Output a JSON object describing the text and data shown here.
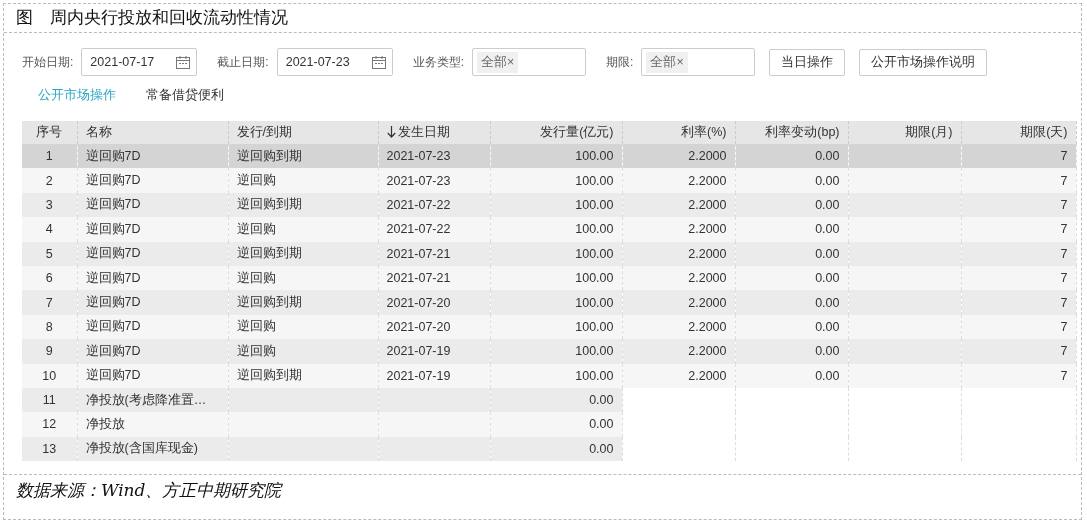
{
  "title": "图　周内央行投放和回收流动性情况",
  "filters": [
    {
      "kind": "date",
      "label": "开始日期:",
      "value": "2021-07-17"
    },
    {
      "kind": "date",
      "label": "截止日期:",
      "value": "2021-07-23"
    },
    {
      "kind": "tags",
      "label": "业务类型:",
      "tag": "全部",
      "remove": "×"
    },
    {
      "kind": "tags",
      "label": "期限:",
      "tag": "全部",
      "remove": "×"
    }
  ],
  "buttons": [
    "当日操作",
    "公开市场操作说明"
  ],
  "tabs": [
    {
      "label": "公开市场操作",
      "selected": true
    },
    {
      "label": "常备借贷便利",
      "selected": false
    }
  ],
  "table": {
    "columns": [
      {
        "label": "序号",
        "sorted": false
      },
      {
        "label": "名称",
        "sorted": false
      },
      {
        "label": "发行/到期",
        "sorted": false
      },
      {
        "label": "发生日期",
        "sorted": true
      },
      {
        "label": "发行量(亿元)",
        "sorted": false
      },
      {
        "label": "利率(%)",
        "sorted": false
      },
      {
        "label": "利率变动(bp)",
        "sorted": false
      },
      {
        "label": "期限(月)",
        "sorted": false
      },
      {
        "label": "期限(天)",
        "sorted": false
      }
    ],
    "rows": [
      {
        "selected": true,
        "cells": [
          "1",
          "逆回购7D",
          "逆回购到期",
          "2021-07-23",
          "100.00",
          "2.2000",
          "0.00",
          null,
          "7"
        ]
      },
      {
        "selected": false,
        "cells": [
          "2",
          "逆回购7D",
          "逆回购",
          "2021-07-23",
          "100.00",
          "2.2000",
          "0.00",
          null,
          "7"
        ]
      },
      {
        "selected": false,
        "cells": [
          "3",
          "逆回购7D",
          "逆回购到期",
          "2021-07-22",
          "100.00",
          "2.2000",
          "0.00",
          null,
          "7"
        ]
      },
      {
        "selected": false,
        "cells": [
          "4",
          "逆回购7D",
          "逆回购",
          "2021-07-22",
          "100.00",
          "2.2000",
          "0.00",
          null,
          "7"
        ]
      },
      {
        "selected": false,
        "cells": [
          "5",
          "逆回购7D",
          "逆回购到期",
          "2021-07-21",
          "100.00",
          "2.2000",
          "0.00",
          null,
          "7"
        ]
      },
      {
        "selected": false,
        "cells": [
          "6",
          "逆回购7D",
          "逆回购",
          "2021-07-21",
          "100.00",
          "2.2000",
          "0.00",
          null,
          "7"
        ]
      },
      {
        "selected": false,
        "cells": [
          "7",
          "逆回购7D",
          "逆回购到期",
          "2021-07-20",
          "100.00",
          "2.2000",
          "0.00",
          null,
          "7"
        ]
      },
      {
        "selected": false,
        "cells": [
          "8",
          "逆回购7D",
          "逆回购",
          "2021-07-20",
          "100.00",
          "2.2000",
          "0.00",
          null,
          "7"
        ]
      },
      {
        "selected": false,
        "cells": [
          "9",
          "逆回购7D",
          "逆回购",
          "2021-07-19",
          "100.00",
          "2.2000",
          "0.00",
          null,
          "7"
        ]
      },
      {
        "selected": false,
        "cells": [
          "10",
          "逆回购7D",
          "逆回购到期",
          "2021-07-19",
          "100.00",
          "2.2000",
          "0.00",
          null,
          "7"
        ]
      },
      {
        "selected": false,
        "cells": [
          "11",
          "净投放(考虑降准置…",
          null,
          null,
          "0.00"
        ]
      },
      {
        "selected": false,
        "cells": [
          "12",
          "净投放",
          null,
          null,
          "0.00"
        ]
      },
      {
        "selected": false,
        "cells": [
          "13",
          "净投放(含国库现金)",
          null,
          null,
          "0.00"
        ]
      }
    ]
  },
  "source": "数据来源：Wind、方正中期研究院"
}
